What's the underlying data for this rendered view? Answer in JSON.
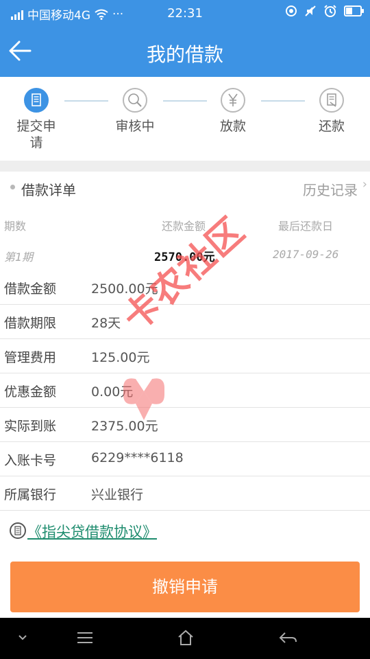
{
  "status_bar": {
    "carrier": "中国移动4G",
    "dots": "···",
    "time": "22:31"
  },
  "header": {
    "title": "我的借款",
    "back_icon": "arrow-left-icon"
  },
  "steps": [
    {
      "label": "提交申请",
      "icon": "document-icon",
      "active": true
    },
    {
      "label": "审核中",
      "icon": "magnifier-icon",
      "active": false
    },
    {
      "label": "放款",
      "icon": "yen-icon",
      "active": false
    },
    {
      "label": "还款",
      "icon": "receipt-icon",
      "active": false
    }
  ],
  "section": {
    "title": "借款详单",
    "history_link": "历史记录"
  },
  "schedule": {
    "columns": [
      "期数",
      "还款金额",
      "最后还款日"
    ],
    "row": {
      "period": "第1期",
      "amount": "2570.00元",
      "due_date": "2017-09-26"
    }
  },
  "details": [
    {
      "label": "借款金额",
      "value": "2500.00元"
    },
    {
      "label": "借款期限",
      "value": "28天"
    },
    {
      "label": "管理费用",
      "value": "125.00元"
    },
    {
      "label": "优惠金额",
      "value": "0.00元"
    },
    {
      "label": "实际到账",
      "value": "2375.00元"
    },
    {
      "label": "入账卡号",
      "value": "6229****6118"
    },
    {
      "label": "所属银行",
      "value": "兴业银行"
    }
  ],
  "agreement": {
    "link": "《指尖贷借款协议》",
    "icon": "document-circle-icon"
  },
  "actions": {
    "cancel_label": "撤销申请"
  },
  "watermark": {
    "text": "卡农社区"
  },
  "colors": {
    "primary": "#3d93e4",
    "cancel": "#fb8d46",
    "link": "#1e8c6e"
  }
}
